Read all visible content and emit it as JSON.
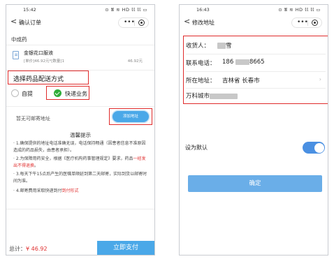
{
  "left": {
    "status": {
      "time": "15:42",
      "icons": "⊙ 𝖀 ≋ HD 𝕝𝕝 𝕝𝕝 ▭"
    },
    "nav": {
      "back": "<",
      "title": "确认订单",
      "menu_dots": "•••"
    },
    "section": "中成药",
    "drug": {
      "name": "金银花口服液",
      "spec": "[单价]46.92元*[数量]1",
      "price": "46.92元"
    },
    "delivery_title": "选择药品配送方式",
    "options": {
      "self_pickup": "自提",
      "express": "快递业务",
      "selected": "快递业务"
    },
    "no_address": "暂无可邮寄地址",
    "add_address_button": "添加地址",
    "tips": {
      "title": "温馨提示",
      "items": [
        {
          "text": "· 1.确保提供的地址电话准确无误，电话保持畅通（因患者信息不准原因造成的药品损失，由患者承担）。"
        },
        {
          "text": "· 2.为保障用药安全，根据《医疗机构药事管理规定》要求，药品",
          "red": "一经发出不得退换",
          "tail": "。"
        },
        {
          "text": "· 3.每天下午15点后产生的医嘱单顺延到第二天邮寄，实际到货以邮寄时间为准。"
        },
        {
          "text": "· 4.邮寄费用采取快递到付",
          "red": "到付形式"
        }
      ]
    },
    "total": {
      "label": "总计：",
      "amount": "¥ 46.92"
    },
    "pay_button": "立即支付"
  },
  "right": {
    "status": {
      "time": "16:43",
      "icons": "⊙ 𝖀 ≋ HD 𝕝𝕝 𝕝𝕝 ▭"
    },
    "nav": {
      "back": "<",
      "title": "修改地址",
      "menu_dots": "•••"
    },
    "form": {
      "recipient_label": "收货人：",
      "recipient_value": "雪",
      "phone_label": "联系电话：",
      "phone_prefix": "186",
      "phone_suffix": "8665",
      "region_label": "所在地址：",
      "region_value": "吉林省 长春市",
      "detail_prefix": "万科城市",
      "chevron": "›"
    },
    "default_label": "设为默认",
    "default_on": true,
    "confirm_button": "确定"
  },
  "colors": {
    "accent_blue": "#4aa8e8",
    "highlight_red": "#e02b2b",
    "selected_green": "#2fae3a",
    "price_red": "#e03030"
  }
}
